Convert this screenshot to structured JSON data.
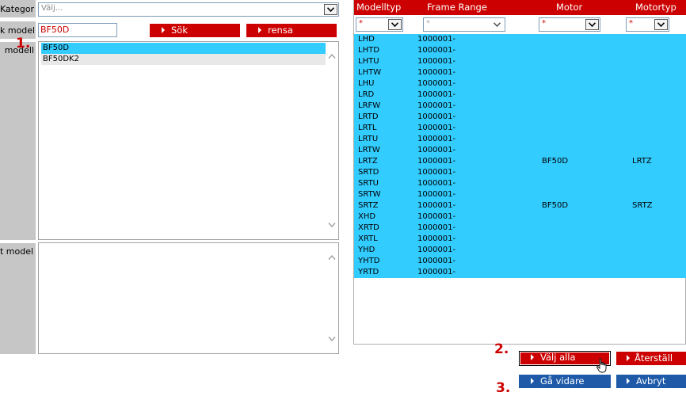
{
  "form": {
    "kategori_label": "Kategori",
    "kategori_select": {
      "value": "Välj..."
    },
    "sok_modell_label": "k modell",
    "search_value": "BF50D",
    "search_button": "Sök",
    "clear_button": "rensa",
    "valj_modell_label": "modell",
    "models": [
      "BF50D",
      "BF50DK2"
    ],
    "selected_modell_label": "t modell"
  },
  "grid": {
    "columns": [
      "Modelltyp",
      "Frame Range",
      "Motor",
      "Motortyp"
    ],
    "filters": [
      "*",
      "*",
      "*",
      "*"
    ],
    "rows": [
      {
        "modelltyp": "LHD",
        "frame": "1000001-",
        "motor": "",
        "motortyp": ""
      },
      {
        "modelltyp": "LHTD",
        "frame": "1000001-",
        "motor": "",
        "motortyp": ""
      },
      {
        "modelltyp": "LHTU",
        "frame": "1000001-",
        "motor": "",
        "motortyp": ""
      },
      {
        "modelltyp": "LHTW",
        "frame": "1000001-",
        "motor": "",
        "motortyp": ""
      },
      {
        "modelltyp": "LHU",
        "frame": "1000001-",
        "motor": "",
        "motortyp": ""
      },
      {
        "modelltyp": "LRD",
        "frame": "1000001-",
        "motor": "",
        "motortyp": ""
      },
      {
        "modelltyp": "LRFW",
        "frame": "1000001-",
        "motor": "",
        "motortyp": ""
      },
      {
        "modelltyp": "LRTD",
        "frame": "1000001-",
        "motor": "",
        "motortyp": ""
      },
      {
        "modelltyp": "LRTL",
        "frame": "1000001-",
        "motor": "",
        "motortyp": ""
      },
      {
        "modelltyp": "LRTU",
        "frame": "1000001-",
        "motor": "",
        "motortyp": ""
      },
      {
        "modelltyp": "LRTW",
        "frame": "1000001-",
        "motor": "",
        "motortyp": ""
      },
      {
        "modelltyp": "LRTZ",
        "frame": "1000001-",
        "motor": "BF50D",
        "motortyp": "LRTZ"
      },
      {
        "modelltyp": "SRTD",
        "frame": "1000001-",
        "motor": "",
        "motortyp": ""
      },
      {
        "modelltyp": "SRTU",
        "frame": "1000001-",
        "motor": "",
        "motortyp": ""
      },
      {
        "modelltyp": "SRTW",
        "frame": "1000001-",
        "motor": "",
        "motortyp": ""
      },
      {
        "modelltyp": "SRTZ",
        "frame": "1000001-",
        "motor": "BF50D",
        "motortyp": "SRTZ"
      },
      {
        "modelltyp": "XHD",
        "frame": "1000001-",
        "motor": "",
        "motortyp": ""
      },
      {
        "modelltyp": "XRTD",
        "frame": "1000001-",
        "motor": "",
        "motortyp": ""
      },
      {
        "modelltyp": "XRTL",
        "frame": "1000001-",
        "motor": "",
        "motortyp": ""
      },
      {
        "modelltyp": "YHD",
        "frame": "1000001-",
        "motor": "",
        "motortyp": ""
      },
      {
        "modelltyp": "YHTD",
        "frame": "1000001-",
        "motor": "",
        "motortyp": ""
      },
      {
        "modelltyp": "YRTD",
        "frame": "1000001-",
        "motor": "",
        "motortyp": ""
      }
    ]
  },
  "actions": {
    "select_all": "Välj alla",
    "reset": "Återställ",
    "continue": "Gå vidare",
    "cancel": "Avbryt"
  },
  "steps": {
    "one": "1.",
    "two": "2.",
    "three": "3."
  },
  "colors": {
    "accent_red": "#cc0000",
    "selection_cyan": "#33ccff",
    "action_blue": "#1e5aa8"
  }
}
